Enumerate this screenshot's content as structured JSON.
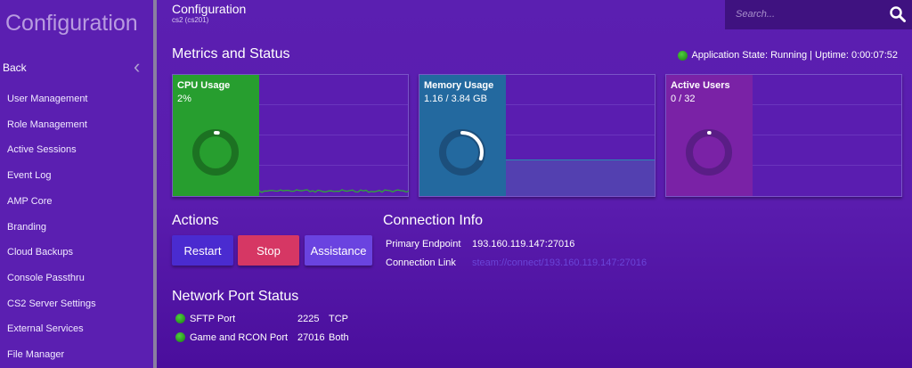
{
  "sidebar": {
    "title": "Configuration",
    "back": "Back",
    "items": [
      "User Management",
      "Role Management",
      "Active Sessions",
      "Event Log",
      "AMP Core",
      "Branding",
      "Cloud Backups",
      "Console Passthru",
      "CS2 Server Settings",
      "External Services",
      "File Manager"
    ]
  },
  "header": {
    "title": "Configuration",
    "subtitle": "cs2 (cs201)"
  },
  "search": {
    "placeholder": "Search..."
  },
  "metrics": {
    "title": "Metrics and Status",
    "state": "Application State: Running | Uptime: 0:00:07:52",
    "cards": [
      {
        "title": "CPU Usage",
        "value": "2%",
        "fraction": 0.02,
        "color": "#279e2f"
      },
      {
        "title": "Memory Usage",
        "value": "1.16 / 3.84 GB",
        "fraction": 0.302,
        "color": "#23699f"
      },
      {
        "title": "Active Users",
        "value": "0 / 32",
        "fraction": 0,
        "color": "#7a22a6"
      }
    ]
  },
  "actions": {
    "title": "Actions",
    "restart": "Restart",
    "stop": "Stop",
    "assistance": "Assistance"
  },
  "connection": {
    "title": "Connection Info",
    "endpoint_label": "Primary Endpoint",
    "endpoint": "193.160.119.147:27016",
    "link_label": "Connection Link",
    "link": "steam://connect/193.160.119.147:27016"
  },
  "ports": {
    "title": "Network Port Status",
    "rows": [
      {
        "name": "SFTP Port",
        "port": "2225",
        "proto": "TCP"
      },
      {
        "name": "Game and RCON Port",
        "port": "27016",
        "proto": "Both"
      }
    ]
  }
}
